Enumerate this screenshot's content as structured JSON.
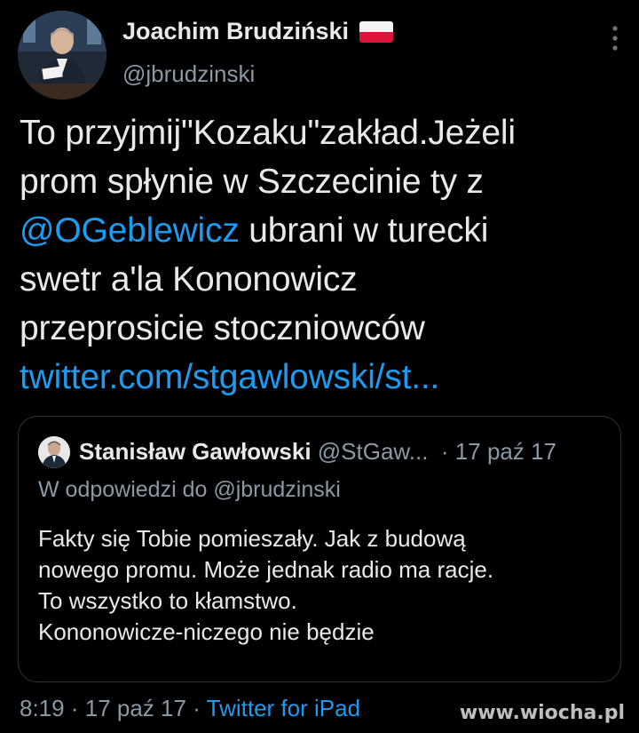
{
  "author": {
    "name": "Joachim Brudziński",
    "handle": "@jbrudzinski"
  },
  "tweet": {
    "line1": "To przyjmij\"Kozaku\"zakład.Jeżeli",
    "line2": "prom spłynie w Szczecinie ty z",
    "mention": "@OGeblewicz",
    "line3_rest": " ubrani w turecki",
    "line4": "swetr a'la Kononowicz",
    "line5": "przeprosicie stoczniowców",
    "link": "twitter.com/stgawlowski/st..."
  },
  "quote": {
    "name": "Stanisław Gawłowski",
    "handle": "@StGaw...",
    "separator": "·",
    "date": "17 paź 17",
    "reply_to": "W odpowiedzi do @jbrudzinski",
    "line1": "Fakty się Tobie pomieszały. Jak z budową",
    "line2": "nowego promu. Może jednak radio ma racje.",
    "line3": "To wszystko to kłamstwo.",
    "line4": "Kononowicze-niczego nie będzie"
  },
  "meta": {
    "time": "8:19",
    "sep1": "·",
    "date": "17 paź 17",
    "sep2": "·",
    "source": "Twitter for iPad"
  },
  "watermark": "www.wiocha.pl",
  "colors": {
    "background": "#000000",
    "text": "#e7e9ea",
    "secondary": "#8b98a5",
    "link": "#1d9bf0",
    "border": "#2f3336"
  },
  "icons": {
    "more": "more-vertical-icon",
    "flag": "poland-flag-icon"
  }
}
